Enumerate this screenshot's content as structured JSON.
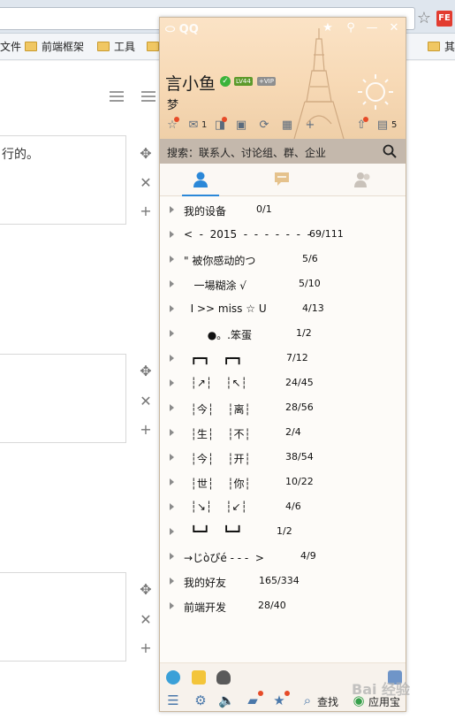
{
  "browser": {
    "bookmarks": [
      "文件",
      "前端框架",
      "工具",
      "其"
    ],
    "extension_label": "FE"
  },
  "page": {
    "card1_text": "行的。",
    "icons": [
      "move-icon",
      "close-icon",
      "plus-icon"
    ]
  },
  "qq": {
    "logo": "QQ",
    "nickname": "言小鱼",
    "level_badge": "LV44",
    "vip_badge": "+VIP",
    "signature": "梦",
    "header_counts": {
      "mail": "1",
      "notify": "5"
    },
    "search_placeholder": "搜索：联系人、讨论组、群、企业",
    "groups": [
      {
        "name": "我的设备",
        "count": "0/1"
      },
      {
        "name": "<  -  2015  -  -  -  -  -  -  -",
        "count": "69/111"
      },
      {
        "name": "\" 被你感动的つ",
        "count": "5/6"
      },
      {
        "name": "   一場糊涂 √",
        "count": "5/10"
      },
      {
        "name": "  I >> miss ☆ U",
        "count": "4/13"
      },
      {
        "name": "       ●。.笨蛋",
        "count": "1/2"
      },
      {
        "name": "  ┏━┓    ┏━┓",
        "count": "7/12"
      },
      {
        "name": "  ┆↗┆    ┆↖┆",
        "count": "24/45"
      },
      {
        "name": "  ┆今┆    ┆离┆",
        "count": "28/56"
      },
      {
        "name": "  ┆生┆    ┆不┆",
        "count": "2/4"
      },
      {
        "name": "  ┆今┆    ┆开┆",
        "count": "38/54"
      },
      {
        "name": "  ┆世┆    ┆你┆",
        "count": "10/22"
      },
      {
        "name": "  ┆↘┆    ┆↙┆",
        "count": "4/6"
      },
      {
        "name": "  ┗━┛    ┗━┛",
        "count": "1/2"
      },
      {
        "name": "→じòぴé - - -  >",
        "count": "4/9"
      },
      {
        "name": "我的好友",
        "count": "165/334"
      },
      {
        "name": "前端开发",
        "count": "28/40"
      }
    ],
    "footer": {
      "find_label": "查找",
      "app_label": "应用宝"
    },
    "colors": {
      "accent": "#2b88d8",
      "header": "#f7d9b5",
      "search_bar": "#9a826e"
    }
  },
  "watermark": "Bai 经验"
}
